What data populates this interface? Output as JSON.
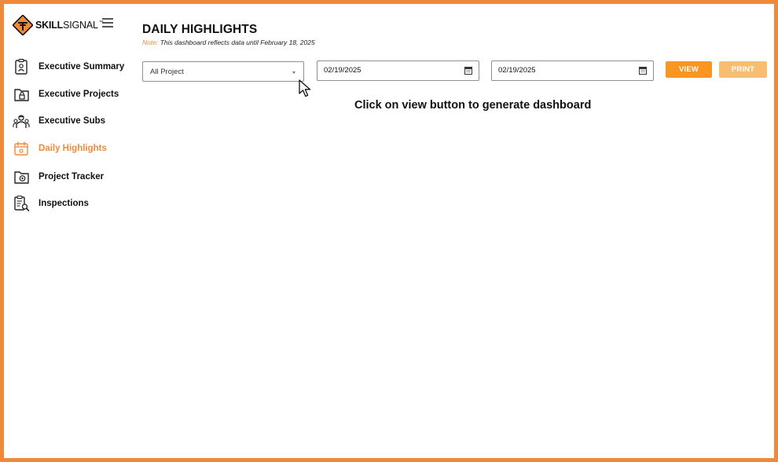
{
  "brand": {
    "name_bold": "SKILL",
    "name_regular": "SIGNAL",
    "trademark": "™",
    "logo_icon": "construction-sign-icon",
    "accent_color": "#ef8a3c"
  },
  "sidebar": {
    "items": [
      {
        "label": "Executive Summary",
        "icon": "clipboard-person-icon",
        "active": false
      },
      {
        "label": "Executive Projects",
        "icon": "folder-lock-icon",
        "active": false
      },
      {
        "label": "Executive Subs",
        "icon": "worker-group-icon",
        "active": false
      },
      {
        "label": "Daily Highlights",
        "icon": "calendar-icon",
        "active": true
      },
      {
        "label": "Project Tracker",
        "icon": "folder-target-icon",
        "active": false
      },
      {
        "label": "Inspections",
        "icon": "checklist-search-icon",
        "active": false
      }
    ]
  },
  "header": {
    "title": "DAILY HIGHLIGHTS",
    "note_label": "Note:",
    "note_text": " This dashboard reflects data until February 18, 2025"
  },
  "filters": {
    "project_select": "All Project",
    "start_date": "02/19/2025",
    "end_date": "02/19/2025"
  },
  "buttons": {
    "view": "VIEW",
    "print": "PRINT",
    "view_color": "#f89621",
    "print_color": "#f9bd72"
  },
  "main": {
    "message": "Click on view button to generate dashboard"
  }
}
